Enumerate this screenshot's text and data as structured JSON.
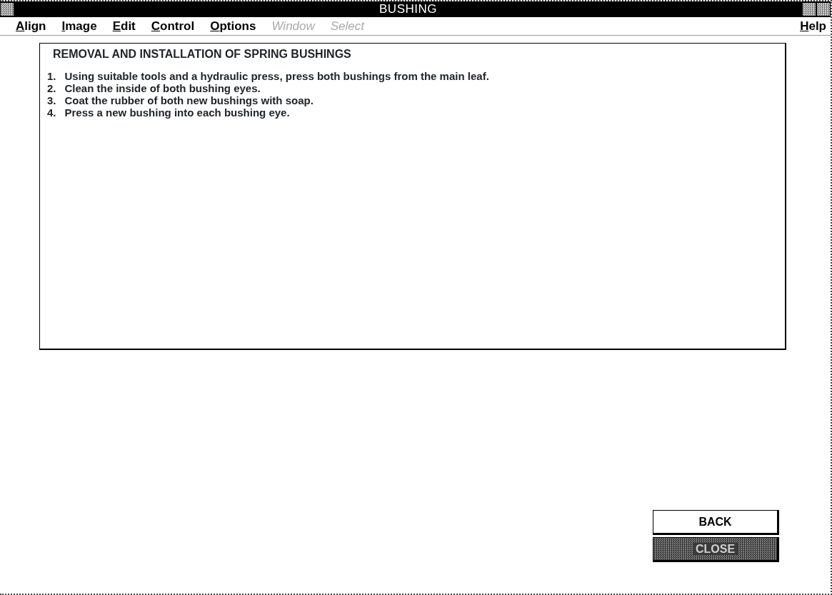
{
  "window": {
    "title": "BUSHING"
  },
  "menu": [
    {
      "label": "Align",
      "mnemonic": true,
      "disabled": false
    },
    {
      "label": "Image",
      "mnemonic": true,
      "disabled": false
    },
    {
      "label": "Edit",
      "mnemonic": true,
      "disabled": false
    },
    {
      "label": "Control",
      "mnemonic": true,
      "disabled": false
    },
    {
      "label": "Options",
      "mnemonic": true,
      "disabled": false
    },
    {
      "label": "Window",
      "mnemonic": false,
      "disabled": true
    },
    {
      "label": "Select",
      "mnemonic": false,
      "disabled": true
    }
  ],
  "help_menu": {
    "label": "Help",
    "mnemonic": true
  },
  "panel": {
    "heading": "REMOVAL AND INSTALLATION OF SPRING BUSHINGS",
    "steps": [
      {
        "number": "1.",
        "text": "Using suitable tools and a hydraulic press, press both bushings from the main leaf."
      },
      {
        "number": "2.",
        "text": "Clean the inside of both bushing eyes."
      },
      {
        "number": "3.",
        "text": "Coat the rubber of both new bushings with soap."
      },
      {
        "number": "4.",
        "text": "Press a new bushing into each bushing eye."
      }
    ]
  },
  "buttons": [
    {
      "label": "BACK",
      "disabled": false
    },
    {
      "label": "CLOSE",
      "disabled": true
    }
  ]
}
